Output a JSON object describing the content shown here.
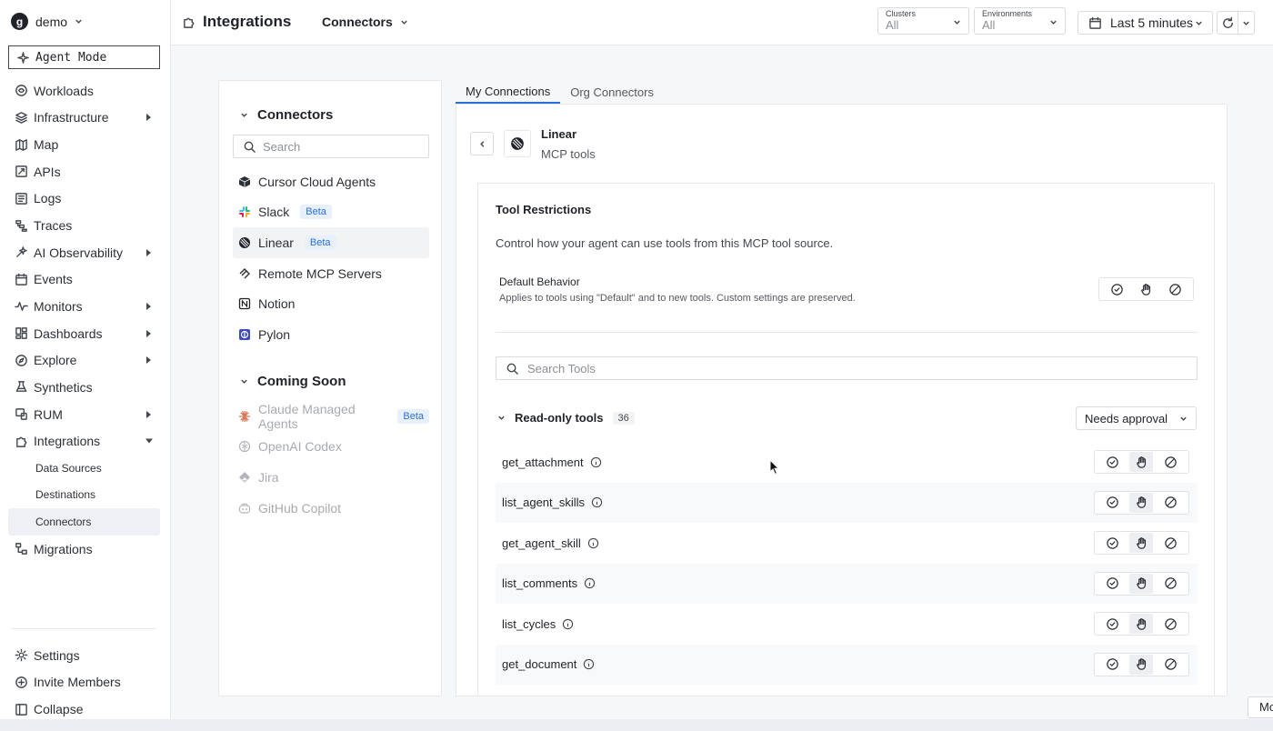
{
  "org": {
    "logo_letter": "g",
    "name": "demo"
  },
  "agent_mode": "Agent Mode",
  "sidebar": {
    "items": [
      {
        "label": "Workloads",
        "icon": "workloads-icon"
      },
      {
        "label": "Infrastructure",
        "icon": "layers-icon",
        "expandable": true
      },
      {
        "label": "Map",
        "icon": "map-icon"
      },
      {
        "label": "APIs",
        "icon": "api-icon"
      },
      {
        "label": "Logs",
        "icon": "logs-icon"
      },
      {
        "label": "Traces",
        "icon": "traces-icon"
      },
      {
        "label": "AI Observability",
        "icon": "ai-observability-icon",
        "expandable": true
      },
      {
        "label": "Events",
        "icon": "calendar-icon"
      },
      {
        "label": "Monitors",
        "icon": "pulse-icon",
        "expandable": true
      },
      {
        "label": "Dashboards",
        "icon": "dashboard-icon",
        "expandable": true
      },
      {
        "label": "Explore",
        "icon": "compass-icon",
        "expandable": true
      },
      {
        "label": "Synthetics",
        "icon": "flask-icon"
      },
      {
        "label": "RUM",
        "icon": "rum-icon",
        "expandable": true
      },
      {
        "label": "Integrations",
        "icon": "puzzle-icon",
        "expanded": true
      }
    ],
    "integrations_sub": [
      "Data Sources",
      "Destinations",
      "Connectors"
    ],
    "migrations": "Migrations",
    "bottom": [
      {
        "label": "Settings",
        "icon": "gear-icon"
      },
      {
        "label": "Invite Members",
        "icon": "plus-circle-icon"
      },
      {
        "label": "Collapse",
        "icon": "collapse-icon"
      }
    ]
  },
  "topbar": {
    "title": "Integrations",
    "section": "Connectors",
    "clusters_label": "Clusters",
    "clusters_value": "All",
    "environments_label": "Environments",
    "environments_value": "All",
    "time_range": "Last 5 minutes"
  },
  "connectors_panel": {
    "heading": "Connectors",
    "search_placeholder": "Search",
    "items": [
      {
        "label": "Cursor Cloud Agents",
        "icon": "cursor-cube-icon",
        "badge": ""
      },
      {
        "label": "Slack",
        "icon": "slack-icon",
        "badge": "Beta"
      },
      {
        "label": "Linear",
        "icon": "linear-icon",
        "badge": "Beta"
      },
      {
        "label": "Remote MCP Servers",
        "icon": "mcp-icon",
        "badge": ""
      },
      {
        "label": "Notion",
        "icon": "notion-icon",
        "badge": ""
      },
      {
        "label": "Pylon",
        "icon": "pylon-icon",
        "badge": ""
      }
    ],
    "coming_soon_heading": "Coming Soon",
    "coming_soon": [
      {
        "label": "Claude Managed Agents",
        "icon": "claude-icon",
        "badge": "Beta"
      },
      {
        "label": "OpenAI Codex",
        "icon": "openai-icon",
        "badge": ""
      },
      {
        "label": "Jira",
        "icon": "jira-icon",
        "badge": ""
      },
      {
        "label": "GitHub Copilot",
        "icon": "copilot-icon",
        "badge": ""
      }
    ]
  },
  "tabs": [
    "My Connections",
    "Org Connectors"
  ],
  "detail": {
    "name": "Linear",
    "subtitle": "MCP tools",
    "restrictions_title": "Tool Restrictions",
    "restrictions_desc": "Control how your agent can use tools from this MCP tool source.",
    "default_title": "Default Behavior",
    "default_desc": "Applies to tools using \"Default\" and to new tools. Custom settings are preserved.",
    "tools_search_placeholder": "Search Tools",
    "group_title": "Read-only tools",
    "group_count": "36",
    "group_policy": "Needs approval",
    "tools": [
      "get_attachment",
      "list_agent_skills",
      "get_agent_skill",
      "list_comments",
      "list_cycles",
      "get_document"
    ]
  },
  "colors": {
    "accent": "#2b6fd6",
    "beta_bg": "#e8f0fc",
    "claude": "#d97757"
  },
  "footer_tab": "Mo"
}
